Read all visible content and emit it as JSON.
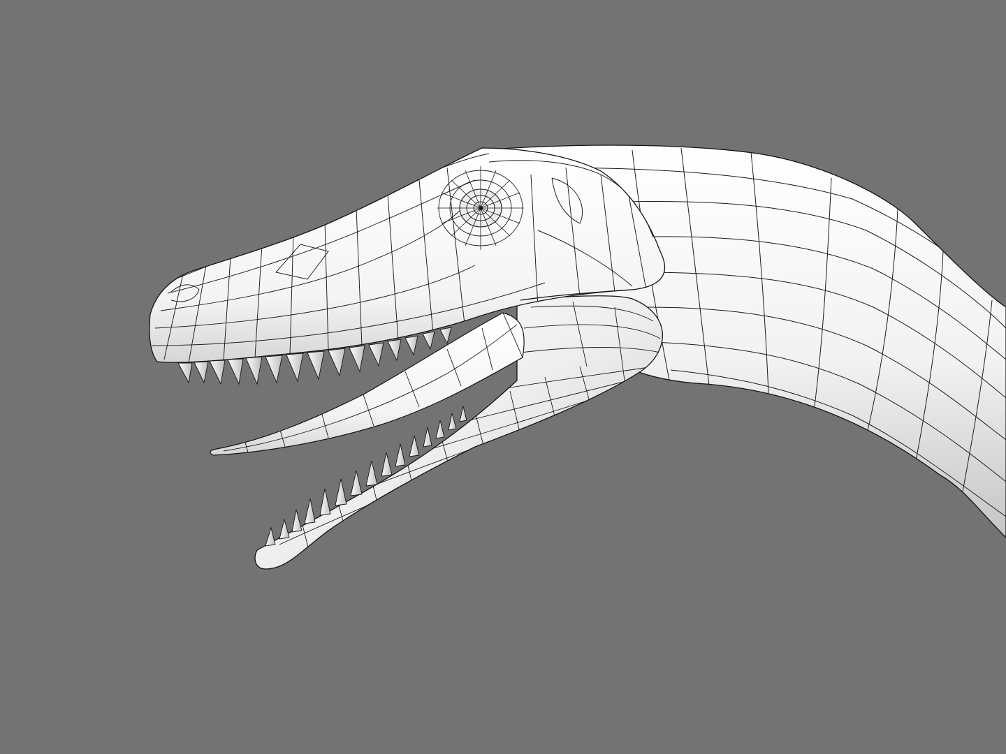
{
  "viewport": {
    "background_color": "#737373",
    "render_style": "shaded-wireframe",
    "surface_color": "#ffffff",
    "wire_color": "#141414"
  },
  "model": {
    "subject": "dinosaur-head-and-neck",
    "view": "side-profile-facing-left",
    "mouth": "open",
    "parts": [
      "upper-jaw",
      "eye",
      "neck",
      "tongue",
      "lower-jaw",
      "upper-teeth",
      "lower-teeth"
    ],
    "upper_teeth_count": 15,
    "lower_teeth_count": 15
  }
}
